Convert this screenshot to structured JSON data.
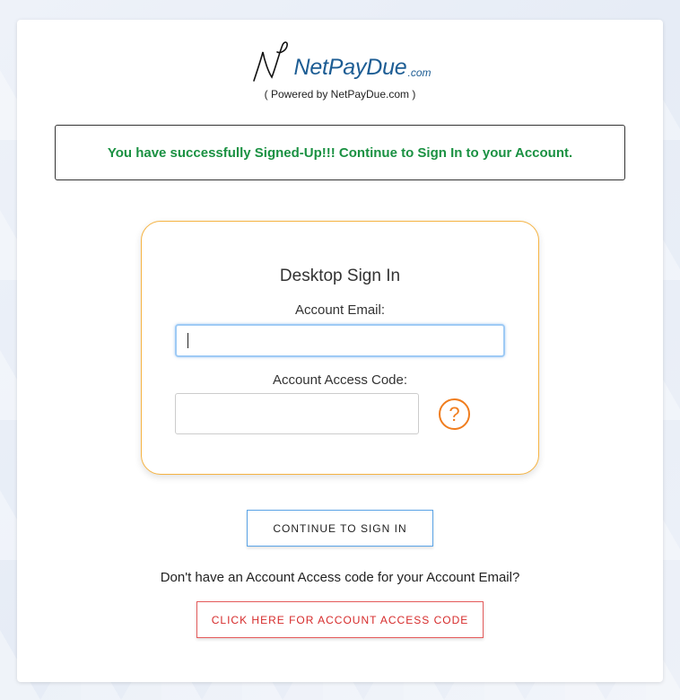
{
  "brand": {
    "name": "NetPayDue",
    "suffix": ".com",
    "powered_by": "( Powered by NetPayDue.com )"
  },
  "alert": {
    "message": "You have successfully Signed-Up!!! Continue to Sign In to your Account."
  },
  "signin": {
    "title": "Desktop Sign In",
    "email_label": "Account Email:",
    "email_value": "",
    "code_label": "Account Access Code:",
    "code_value": "",
    "help_symbol": "?"
  },
  "actions": {
    "continue_label": "CONTINUE TO SIGN IN",
    "no_code_prompt": "Don't have an Account Access code for your Account Email?",
    "access_code_label": "CLICK HERE FOR ACCOUNT ACCESS CODE"
  },
  "colors": {
    "brand_blue": "#1d5d94",
    "success_green": "#1a9142",
    "panel_border": "#f5b342",
    "help_orange": "#f07d1e",
    "continue_border": "#5aa3e6",
    "access_red": "#d62b2b"
  },
  "icons": {
    "logo": "np-signature-logo",
    "help": "question-circle-icon"
  }
}
